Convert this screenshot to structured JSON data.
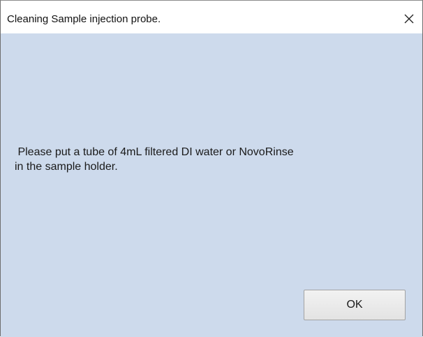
{
  "dialog": {
    "title": "Cleaning Sample injection probe.",
    "close_icon": "close-icon",
    "message_line1": " Please put a tube of 4mL filtered DI water or NovoRinse",
    "message_line2": "in the sample holder.",
    "ok_label": "OK"
  },
  "colors": {
    "client_background": "#cddaec",
    "titlebar_background": "#ffffff"
  }
}
